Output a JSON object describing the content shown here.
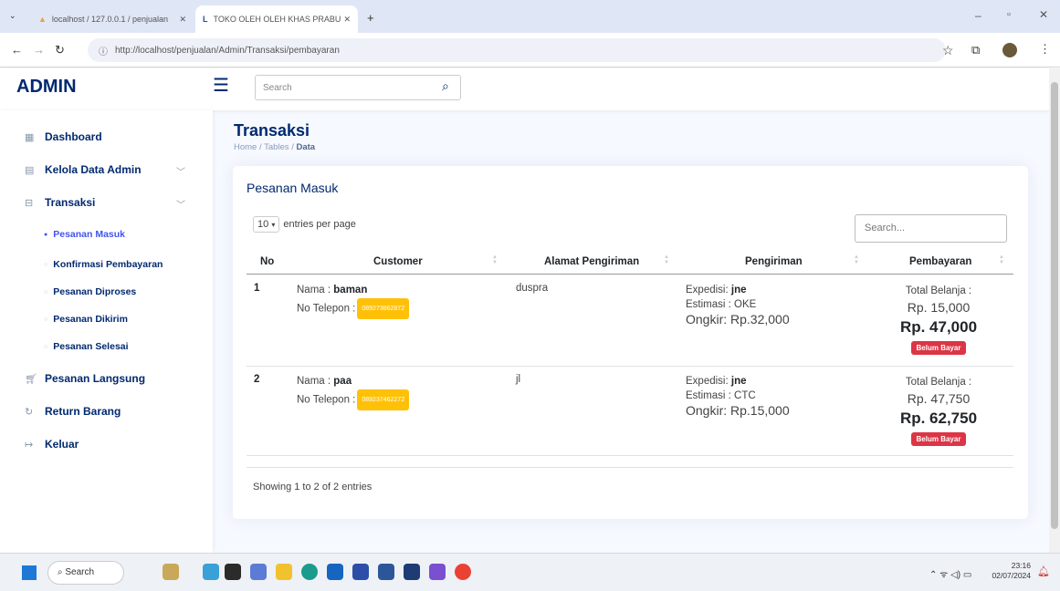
{
  "browser": {
    "tab1_title": "localhost / 127.0.0.1 / penjualan",
    "tab2_title": "TOKO OLEH OLEH KHAS PRABU",
    "url": "http://localhost/penjualan/Admin/Transaksi/pembayaran"
  },
  "header": {
    "logo": "ADMIN",
    "search_placeholder": "Search"
  },
  "sidebar": {
    "dashboard": "Dashboard",
    "kelola": "Kelola Data Admin",
    "transaksi": "Transaksi",
    "sub": [
      "Pesanan Masuk",
      "Konfirmasi Pembayaran",
      "Pesanan Diproses",
      "Pesanan Dikirim",
      "Pesanan Selesai"
    ],
    "langsung": "Pesanan Langsung",
    "return": "Return Barang",
    "keluar": "Keluar"
  },
  "page": {
    "title": "Transaksi",
    "crumb_home": "Home",
    "crumb_tables": "Tables",
    "crumb_data": "Data",
    "card_title": "Pesanan Masuk",
    "per_page_value": "10",
    "per_page_label": "entries per page",
    "search_placeholder": "Search...",
    "showing": "Showing 1 to 2 of 2 entries"
  },
  "table": {
    "headers": [
      "No",
      "Customer",
      "Alamat Pengiriman",
      "Pengiriman",
      "Pembayaran"
    ],
    "rows": [
      {
        "no": "1",
        "nama_label": "Nama :",
        "nama": "baman",
        "telp_label": "No Telepon :",
        "telp": "089273862872",
        "alamat": "duspra",
        "exp_label": "Expedisi:",
        "expedisi": "jne",
        "estimasi": "Estimasi : OKE",
        "ongkir": "Ongkir: Rp.32,000",
        "total_label": "Total Belanja :",
        "total": "Rp. 15,000",
        "grand": "Rp. 47,000",
        "status": "Belum Bayar"
      },
      {
        "no": "2",
        "nama_label": "Nama :",
        "nama": "paa",
        "telp_label": "No Telepon :",
        "telp": "089237462272",
        "alamat": "jl",
        "exp_label": "Expedisi:",
        "expedisi": "jne",
        "estimasi": "Estimasi : CTC",
        "ongkir": "Ongkir: Rp.15,000",
        "total_label": "Total Belanja :",
        "total": "Rp. 47,750",
        "grand": "Rp. 62,750",
        "status": "Belum Bayar"
      }
    ]
  },
  "taskbar": {
    "search": "Search",
    "time": "23:16",
    "date": "02/07/2024"
  }
}
